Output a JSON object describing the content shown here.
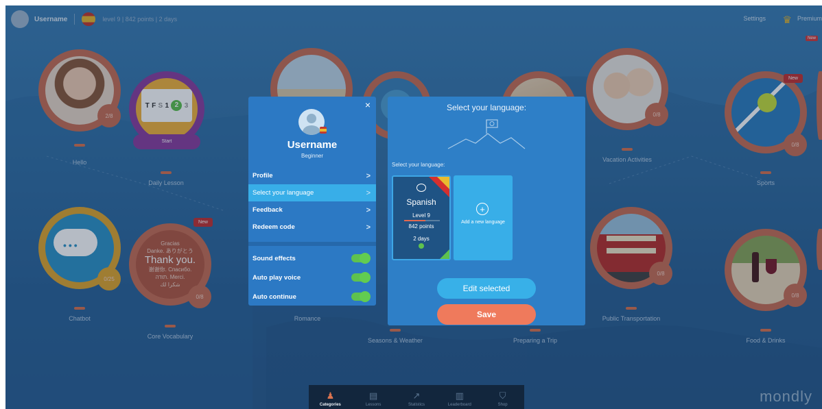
{
  "topbar": {
    "username": "Username",
    "stats": "level 9 | 842 points | 2 days",
    "settings_label": "Settings",
    "premium_label": "Premium",
    "new_tiny": "New"
  },
  "pins": {
    "hello": {
      "label": "Hello",
      "progress": "2/8"
    },
    "daily": {
      "label": "Daily Lesson",
      "start": "Start",
      "cal_days": [
        "T",
        "F",
        "S"
      ],
      "cal_dates": [
        "1",
        "2",
        "3"
      ]
    },
    "vacation": {
      "label": "Vacation Activities",
      "progress": "0/8"
    },
    "sports": {
      "label": "Sports",
      "progress": "0/8",
      "new": "New"
    },
    "chatbot": {
      "label": "Chatbot",
      "progress": "0/25"
    },
    "core": {
      "label": "Core Vocabulary",
      "progress": "0/8",
      "new": "New",
      "words": [
        "Gracias",
        "Danke. ありがとう",
        "Thank you.",
        "谢谢你. Спасибо.",
        "תודה. Merci.",
        "شكرا لك"
      ]
    },
    "romance": {
      "label": "Romance"
    },
    "seasons": {
      "label": "Seasons & Weather"
    },
    "trip": {
      "label": "Preparing a Trip"
    },
    "transport": {
      "label": "Public Transportation",
      "progress": "0/8"
    },
    "food": {
      "label": "Food & Drinks",
      "progress": "0/8"
    }
  },
  "profile": {
    "close": "×",
    "name": "Username",
    "level": "Beginner",
    "menu": [
      {
        "label": "Profile",
        "chev": ">"
      },
      {
        "label": "Select your language",
        "chev": ">"
      },
      {
        "label": "Feedback",
        "chev": ">"
      },
      {
        "label": "Redeem code",
        "chev": ">"
      }
    ],
    "toggles": [
      {
        "label": "Sound effects",
        "on": true
      },
      {
        "label": "Auto play voice",
        "on": true
      },
      {
        "label": "Auto continue",
        "on": true
      }
    ]
  },
  "language": {
    "title": "Select your language:",
    "subtitle": "Select your language:",
    "selected_card": {
      "name": "Spanish",
      "level": "Level 9",
      "level_progress": 0.6,
      "points": "842 points",
      "days": "2 days"
    },
    "add_card": {
      "plus": "+",
      "label": "Add a new language"
    },
    "edit_button": "Edit selected",
    "save_button": "Save"
  },
  "nav": [
    {
      "label": "Categories",
      "icon": "♟",
      "active": true
    },
    {
      "label": "Lessons",
      "icon": "▤",
      "active": false
    },
    {
      "label": "Statistics",
      "icon": "↗",
      "active": false
    },
    {
      "label": "Leaderboard",
      "icon": "▥",
      "active": false
    },
    {
      "label": "Shop",
      "icon": "⛉",
      "active": false
    }
  ],
  "logo": "mondly",
  "colors": {
    "accent": "#38aee8",
    "save": "#ef7a5c",
    "pin": "#c86f55",
    "panel": "#2c79c4",
    "toggle_on": "#5ec24e"
  }
}
